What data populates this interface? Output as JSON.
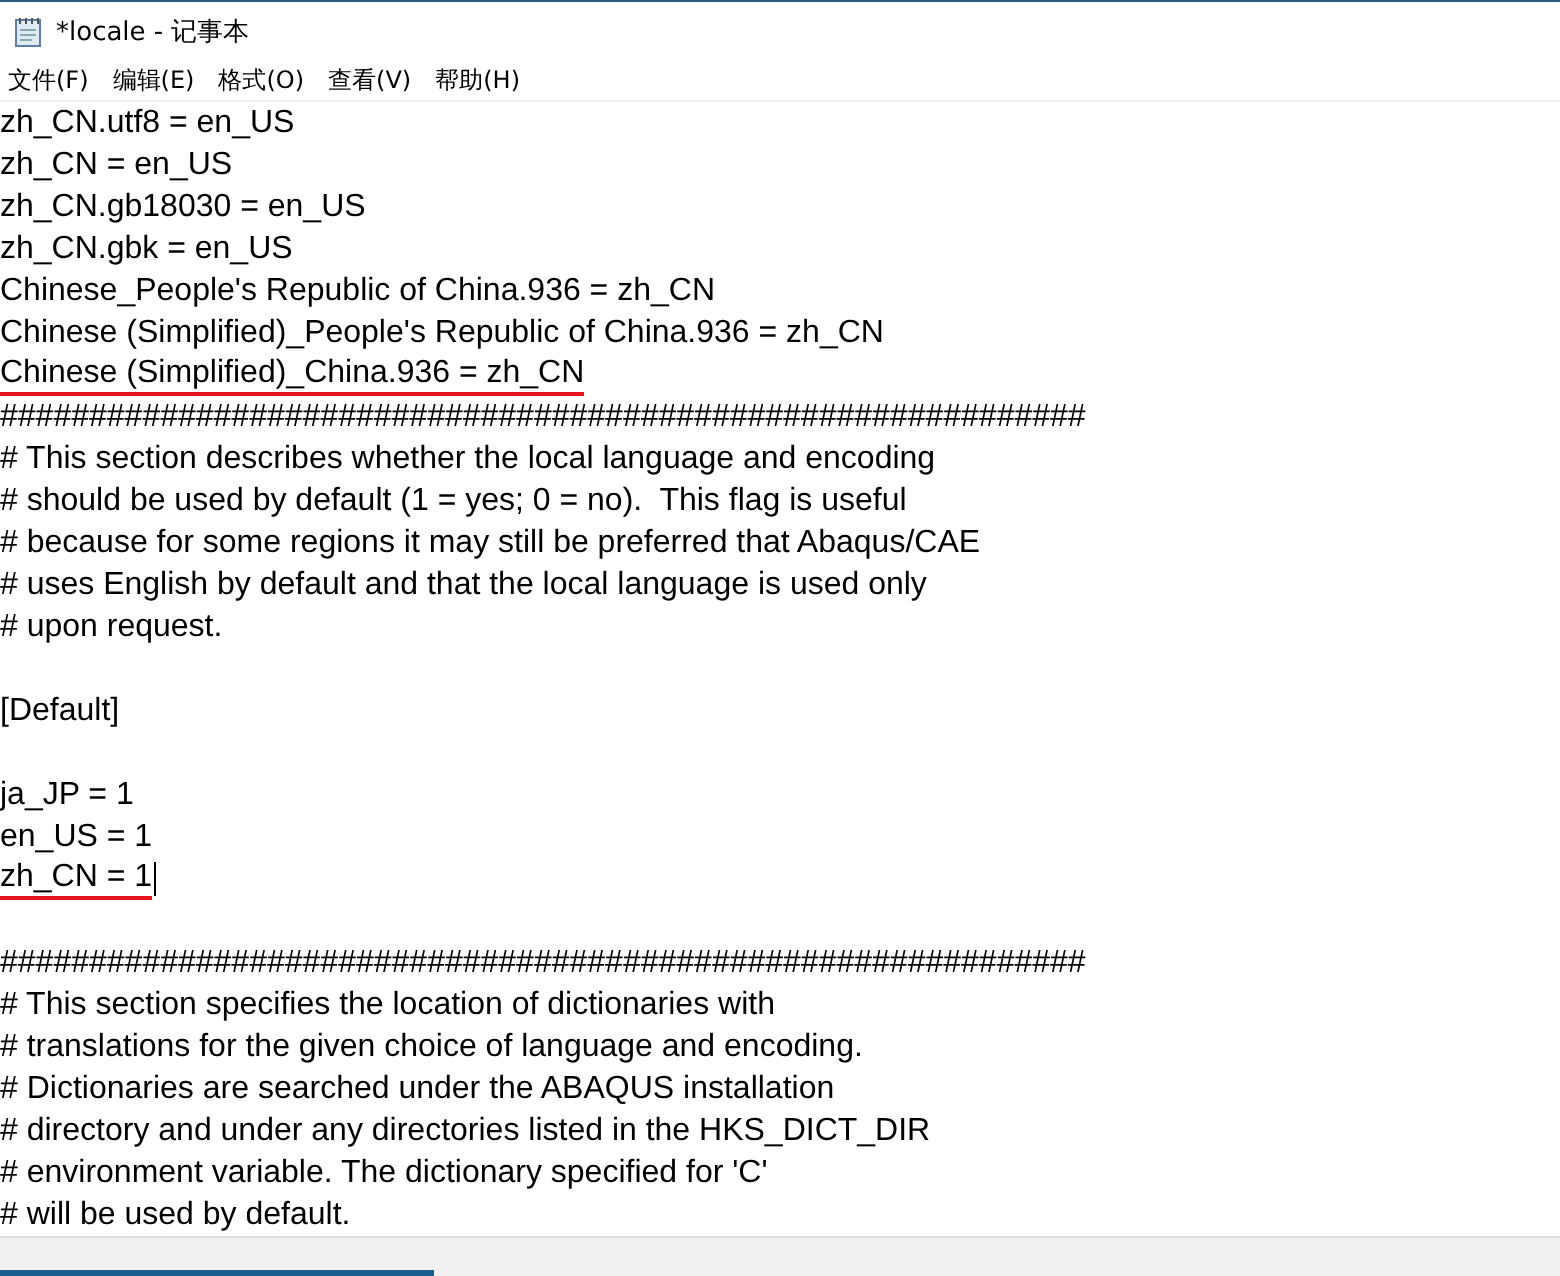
{
  "window": {
    "title": "*locale - 记事本"
  },
  "menu": [
    {
      "label": "文件(F)"
    },
    {
      "label": "编辑(E)"
    },
    {
      "label": "格式(O)"
    },
    {
      "label": "查看(V)"
    },
    {
      "label": "帮助(H)"
    }
  ],
  "blocks": [
    {
      "lines": [
        {
          "text": "zh_CN.utf8 = en_US"
        },
        {
          "text": "zh_CN = en_US"
        },
        {
          "text": "zh_CN.gb18030 = en_US"
        },
        {
          "text": "zh_CN.gbk = en_US"
        },
        {
          "text": "Chinese_People's Republic of China.936 = zh_CN"
        },
        {
          "text": "Chinese (Simplified)_People's Republic of China.936 = zh_CN"
        },
        {
          "text": "Chinese (Simplified)_China.936 = zh_CN",
          "underline": true
        },
        {
          "text": "#############################################################"
        },
        {
          "text": "# This section describes whether the local language and encoding"
        },
        {
          "text": "# should be used by default (1 = yes; 0 = no).  This flag is useful"
        },
        {
          "text": "# because for some regions it may still be preferred that Abaqus/CAE"
        },
        {
          "text": "# uses English by default and that the local language is used only"
        },
        {
          "text": "# upon request."
        }
      ]
    },
    {
      "lines": [
        {
          "text": "[Default]"
        }
      ]
    },
    {
      "lines": [
        {
          "text": "ja_JP = 1"
        },
        {
          "text": "en_US = 1"
        },
        {
          "text": "zh_CN = 1",
          "underline": true,
          "cursor": true
        }
      ]
    },
    {
      "lines": [
        {
          "text": "#############################################################"
        },
        {
          "text": "# This section specifies the location of dictionaries with"
        },
        {
          "text": "# translations for the given choice of language and encoding."
        },
        {
          "text": "# Dictionaries are searched under the ABAQUS installation"
        },
        {
          "text": "# directory and under any directories listed in the HKS_DICT_DIR"
        },
        {
          "text": "# environment variable. The dictionary specified for 'C'"
        },
        {
          "text": "# will be used by default."
        }
      ]
    }
  ]
}
